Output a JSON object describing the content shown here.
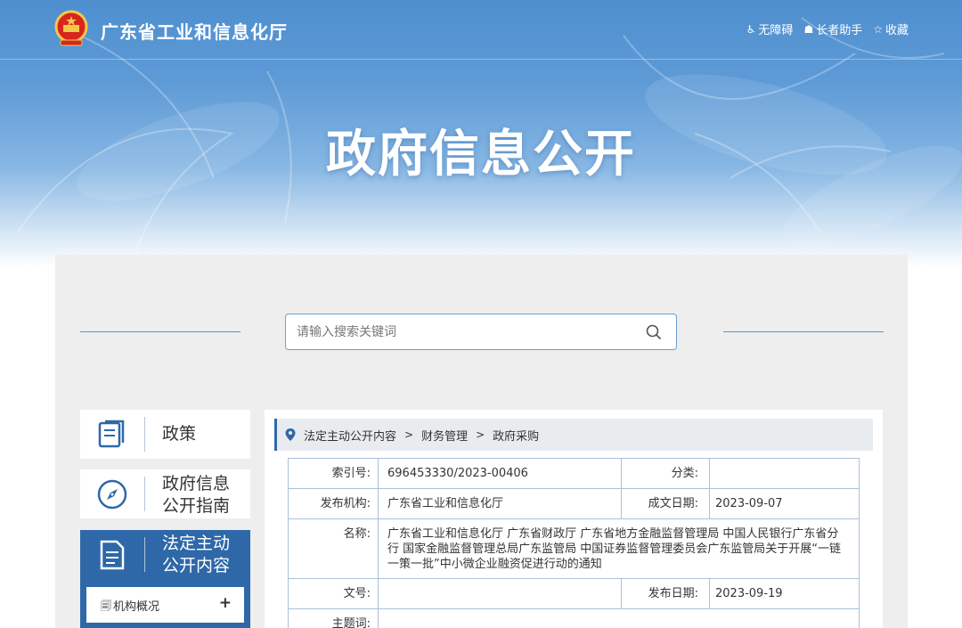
{
  "header": {
    "site_name": "广东省工业和信息化厅",
    "links": [
      {
        "icon": "accessibility-icon",
        "label": "无障碍"
      },
      {
        "icon": "elder-helper-icon",
        "label": "长者助手"
      },
      {
        "icon": "star-icon",
        "label": "收藏"
      }
    ],
    "hero_title": "政府信息公开"
  },
  "search": {
    "placeholder": "请输入搜索关键词",
    "icon": "search-icon"
  },
  "sidebar": {
    "items": [
      {
        "icon": "book-icon",
        "label": "政策",
        "active": false
      },
      {
        "icon": "compass-icon",
        "label_lines": [
          "政府信息",
          "公开指南"
        ],
        "active": false
      },
      {
        "icon": "document-icon",
        "label_lines": [
          "法定主动",
          "公开内容"
        ],
        "active": true
      }
    ],
    "sub_items": [
      {
        "icon": "page-icon",
        "label": "机构概况",
        "expand": "+"
      }
    ]
  },
  "breadcrumb": {
    "icon": "location-pin-icon",
    "items": [
      "法定主动公开内容",
      "财务管理",
      "政府采购"
    ],
    "separator": ">"
  },
  "info": {
    "index_label": "索引号:",
    "index_value": "696453330/2023-00406",
    "category_label": "分类:",
    "category_value": "",
    "publisher_label": "发布机构:",
    "publisher_value": "广东省工业和信息化厅",
    "created_label": "成文日期:",
    "created_value": "2023-09-07",
    "name_label": "名称:",
    "name_value": "广东省工业和信息化厅 广东省财政厅 广东省地方金融监督管理局 中国人民银行广东省分行 国家金融监督管理总局广东监管局 中国证券监督管理委员会广东监管局关于开展“一链一策一批”中小微企业融资促进行动的通知",
    "doc_no_label": "文号:",
    "doc_no_value": "",
    "publish_date_label": "发布日期:",
    "publish_date_value": "2023-09-19",
    "subject_label": "主题词:",
    "subject_value": ""
  },
  "colors": {
    "primary": "#2e68a8",
    "border": "#a9c1dc",
    "panel_bg": "#eeeeee"
  }
}
